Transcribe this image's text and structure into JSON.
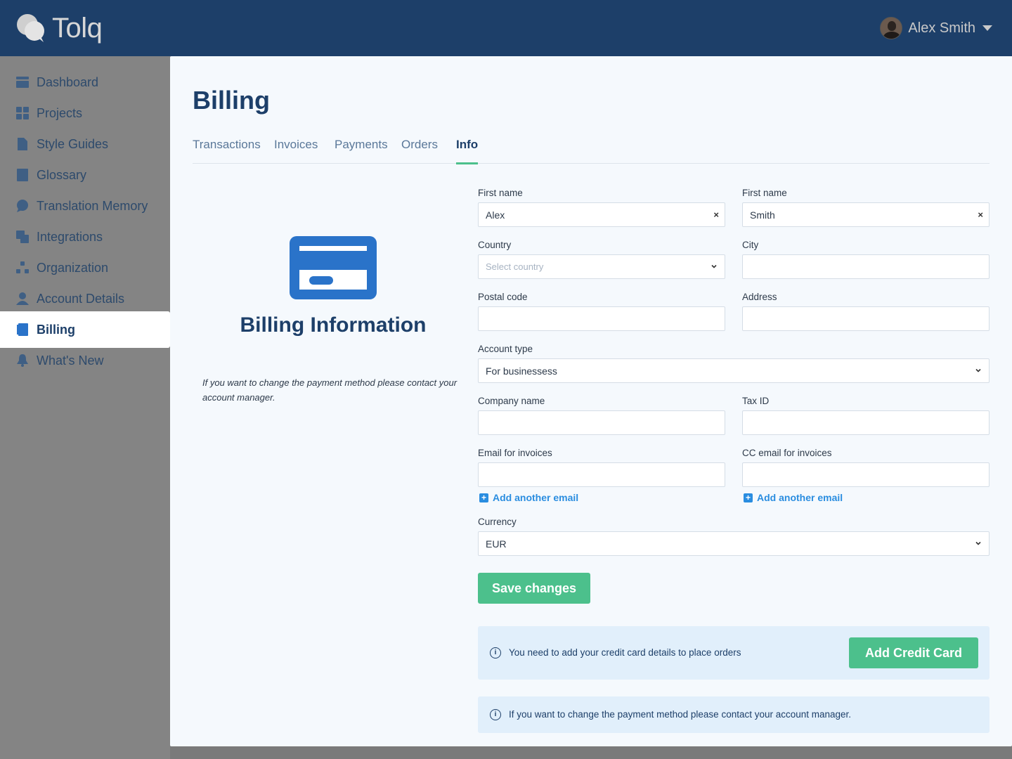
{
  "header": {
    "app_name": "Tolq",
    "user_name": "Alex Smith"
  },
  "sidebar": {
    "items": [
      {
        "label": "Dashboard",
        "icon": "dashboard-icon"
      },
      {
        "label": "Projects",
        "icon": "grid-icon"
      },
      {
        "label": "Style Guides",
        "icon": "document-icon"
      },
      {
        "label": "Glossary",
        "icon": "book-icon"
      },
      {
        "label": "Translation Memory",
        "icon": "chat-bubble-icon"
      },
      {
        "label": "Integrations",
        "icon": "layers-icon"
      },
      {
        "label": "Organization",
        "icon": "hierarchy-icon"
      },
      {
        "label": "Account Details",
        "icon": "user-icon"
      },
      {
        "label": "Billing",
        "icon": "receipt-icon",
        "active": true
      },
      {
        "label": "What's New",
        "icon": "bell-icon"
      }
    ]
  },
  "page": {
    "title": "Billing",
    "tabs": [
      "Transactions",
      "Invoices",
      "Payments",
      "Orders",
      "Info"
    ],
    "active_tab": "Info"
  },
  "info_panel": {
    "title": "Billing Information",
    "note": "If you want to change the payment method please contact your account manager."
  },
  "form": {
    "first_name_label": "First name",
    "first_name_value": "Alex",
    "last_name_label": "First name",
    "last_name_value": "Smith",
    "country_label": "Country",
    "country_placeholder": "Select country",
    "city_label": "City",
    "postal_code_label": "Postal code",
    "address_label": "Address",
    "account_type_label": "Account type",
    "account_type_value": "For businessess",
    "company_name_label": "Company name",
    "tax_id_label": "Tax ID",
    "email_label": "Email for invoices",
    "cc_email_label": "CC email for invoices",
    "add_email_link": "Add another email",
    "add_cc_email_link": "Add another email",
    "currency_label": "Currency",
    "currency_value": "EUR",
    "clear_symbol": "×",
    "save_button": "Save changes"
  },
  "notices": {
    "credit_card_msg": "You need to add your credit card details to place orders",
    "add_card_button": "Add Credit Card",
    "payment_method_msg": "If you want to change the payment method please contact your account manager.",
    "info_symbol": "i"
  },
  "colors": {
    "header_bg": "#1d3f69",
    "accent_green": "#4cc08c",
    "link_blue": "#2a8de0",
    "card_blue": "#2a73c9"
  }
}
